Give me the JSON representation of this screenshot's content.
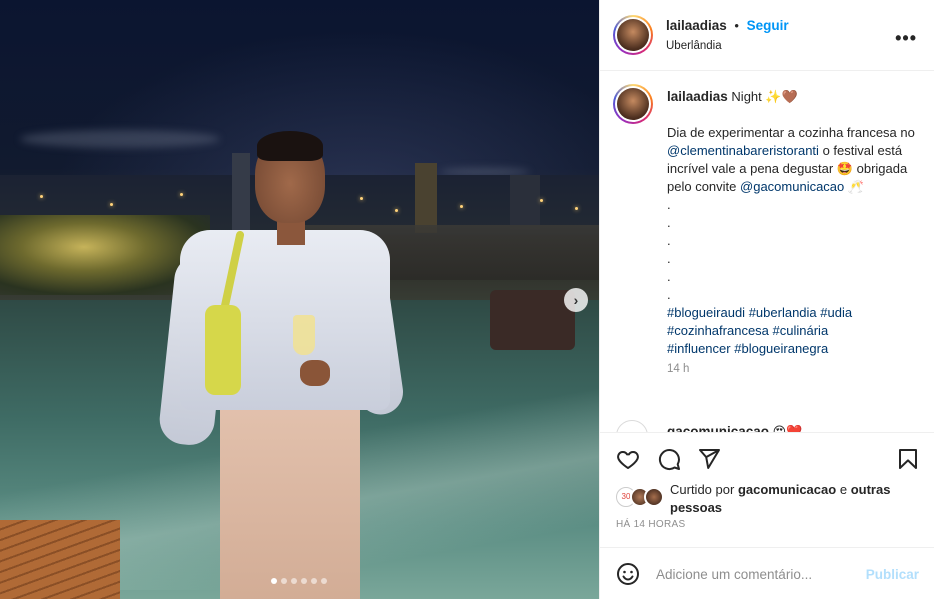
{
  "post": {
    "username": "lailaadias",
    "separator": "•",
    "follow_label": "Seguir",
    "location": "Uberlândia",
    "more_label": "•••"
  },
  "caption": {
    "username": "lailaadias",
    "title": "Night ✨🤎",
    "body_1": "Dia de experimentar a cozinha francesa no",
    "mention_1": "@clementinabareristoranti",
    "body_2": "o festival está incrível vale a pena degustar 🤩 obrigada pelo convite",
    "mention_2": "@gacomunicacao",
    "body_3": "🥂",
    "dots": [
      ".",
      ".",
      ".",
      ".",
      ".",
      "."
    ],
    "hashtags": [
      "#blogueiraudi",
      "#uberlandia",
      "#udia",
      "#cozinhafrancesa",
      "#culinária",
      "#influencer",
      "#blogueiranegra"
    ],
    "time": "14 h"
  },
  "comment_preview": {
    "username": "gacomunicacao",
    "text": "😍❤️"
  },
  "likes": {
    "prefix": "Curtido por",
    "user": "gacomunicacao",
    "conjunction": "e",
    "others": "outras pessoas",
    "badge": "30"
  },
  "timestamp": "HÁ 14 HORAS",
  "add_comment": {
    "placeholder": "Adicione um comentário...",
    "post_label": "Publicar"
  },
  "carousel": {
    "next_label": "›",
    "slide_count": 6,
    "active_index": 0
  },
  "icons": [
    "heart-icon",
    "comment-icon",
    "share-icon",
    "bookmark-icon",
    "emoji-icon",
    "more-icon",
    "next-icon"
  ],
  "colors": {
    "link": "#0095f6",
    "tag": "#00376b",
    "muted": "#8e8e8e",
    "publish_disabled": "#b2dffc"
  }
}
